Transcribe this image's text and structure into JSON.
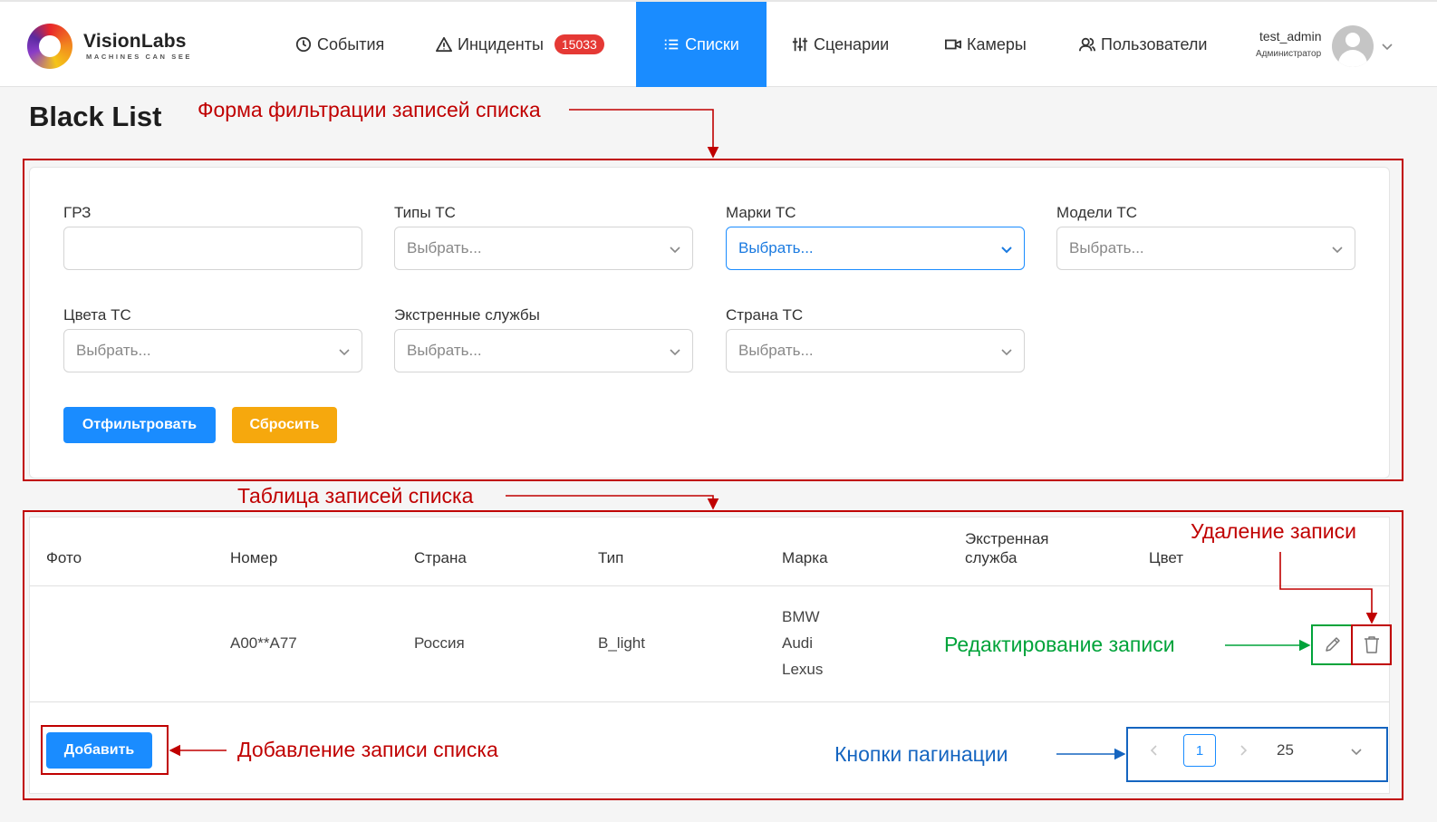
{
  "header": {
    "brand": "VisionLabs",
    "brand_sub": "MACHINES CAN SEE",
    "nav": [
      {
        "label": "События",
        "icon": "clock-icon"
      },
      {
        "label": "Инциденты",
        "icon": "warning-icon",
        "badge": "15033"
      },
      {
        "label": "Списки",
        "icon": "list-icon",
        "active": true
      },
      {
        "label": "Сценарии",
        "icon": "sliders-icon"
      },
      {
        "label": "Камеры",
        "icon": "camera-icon"
      },
      {
        "label": "Пользователи",
        "icon": "users-icon"
      }
    ],
    "user": {
      "name": "test_admin",
      "role": "Администратор"
    }
  },
  "page": {
    "title": "Black List"
  },
  "filter": {
    "fields": [
      {
        "label": "ГРЗ",
        "type": "text",
        "value": ""
      },
      {
        "label": "Типы ТС",
        "type": "select",
        "placeholder": "Выбрать..."
      },
      {
        "label": "Марки ТС",
        "type": "select",
        "placeholder": "Выбрать..."
      },
      {
        "label": "Модели ТС",
        "type": "select",
        "placeholder": "Выбрать..."
      },
      {
        "label": "Цвета ТС",
        "type": "select",
        "placeholder": "Выбрать..."
      },
      {
        "label": "Экстренные службы",
        "type": "select",
        "placeholder": "Выбрать..."
      },
      {
        "label": "Страна ТС",
        "type": "select",
        "placeholder": "Выбрать..."
      }
    ],
    "filter_button": "Отфильтровать",
    "reset_button": "Сбросить"
  },
  "table": {
    "columns": [
      "Фото",
      "Номер",
      "Страна",
      "Тип",
      "Марка",
      "Экстренная служба",
      "Цвет"
    ],
    "columns_split": {
      "emergency_line1": "Экстренная",
      "emergency_line2": "служба"
    },
    "rows": [
      {
        "photo": "",
        "number": "А00**А77",
        "country": "Россия",
        "type": "B_light",
        "brands": [
          "BMW",
          "Audi",
          "Lexus"
        ],
        "emergency": "",
        "color": ""
      }
    ],
    "add_button": "Добавить",
    "pagination": {
      "current_page": "1",
      "page_size": "25"
    }
  },
  "annotations": {
    "filter_form": "Форма фильтрации записей списка",
    "records_table": "Таблица записей списка",
    "delete_record": "Удаление записи",
    "edit_record": "Редактирование записи",
    "add_record": "Добавление записи списка",
    "pagination": "Кнопки пагинации"
  },
  "colors": {
    "primary": "#1a8cff",
    "warning": "#f6a80d",
    "badge": "#e53935",
    "annotation_red": "#c00000",
    "annotation_green": "#00a33a",
    "annotation_blue": "#1565c0"
  }
}
